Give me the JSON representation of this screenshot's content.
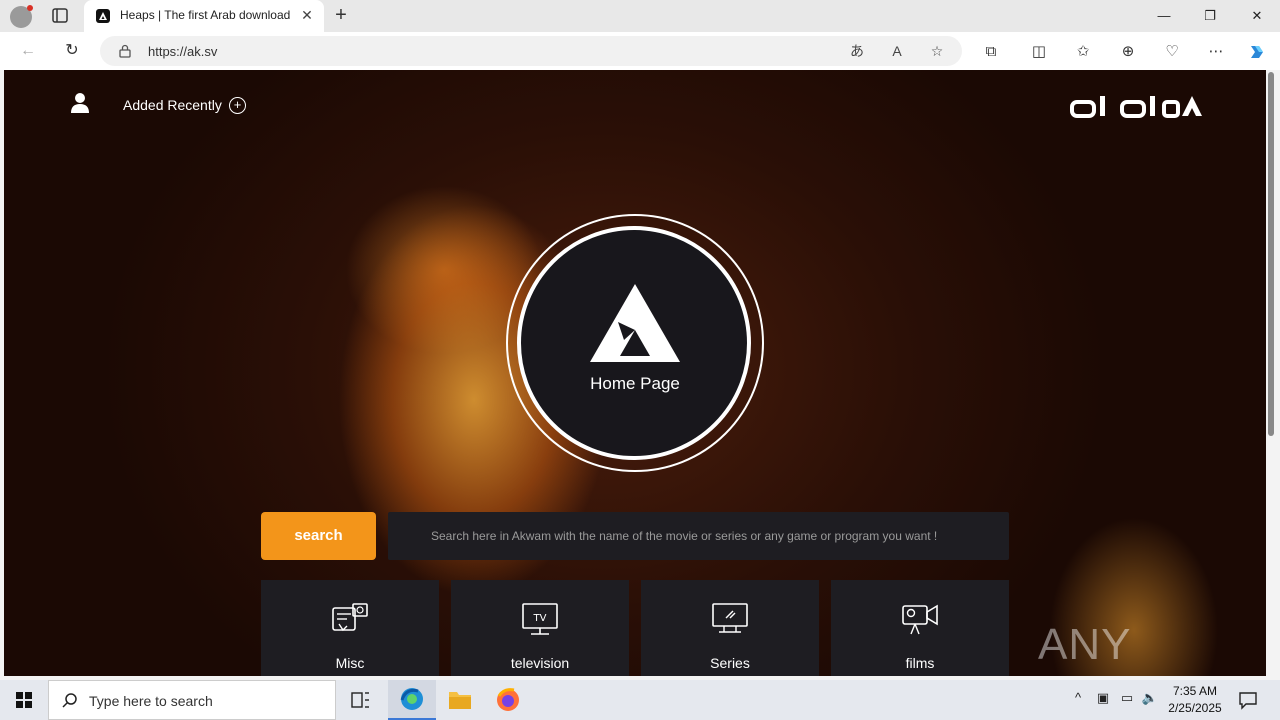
{
  "browser": {
    "tab_title": "Heaps | The first Arab download",
    "new_tab_symbol": "+",
    "close_tab_symbol": "✕",
    "url": "https://ak.sv",
    "window_controls": {
      "minimize": "—",
      "restore": "❐",
      "close": "✕"
    }
  },
  "header": {
    "added_recently": "Added Recently",
    "plus_symbol": "+",
    "logo_alt": "اكوام"
  },
  "hero": {
    "home_label": "Home Page"
  },
  "search": {
    "button_label": "search",
    "placeholder": "Search here in Akwam with the name of the movie or series or any game or program you want !"
  },
  "categories": [
    {
      "label": "Misc",
      "icon": "misc-icon"
    },
    {
      "label": "television",
      "icon": "television-icon"
    },
    {
      "label": "Series",
      "icon": "series-icon"
    },
    {
      "label": "films",
      "icon": "films-icon"
    }
  ],
  "watermark": {
    "text": "ANY RUN"
  },
  "taskbar": {
    "search_placeholder": "Type here to search",
    "time": "7:35 AM",
    "date": "2/25/2025"
  },
  "colors": {
    "accent": "#f3951a",
    "card_bg": "#1e1d22",
    "circle_bg": "#18171c"
  }
}
